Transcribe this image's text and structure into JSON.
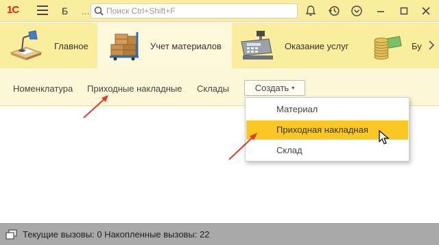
{
  "titlebar": {
    "logo": "1С",
    "app_title": "Б",
    "app_title_sep": "...",
    "search_placeholder": "Поиск Ctrl+Shift+F",
    "icons": [
      "bell-icon",
      "history-icon",
      "settings-menu-icon",
      "minimize-icon",
      "maximize-icon",
      "close-icon"
    ]
  },
  "sections": {
    "items": [
      {
        "label": "Главное",
        "icon": "desk-lamp-icon",
        "active": false
      },
      {
        "label": "Учет материалов",
        "icon": "boxes-cart-icon",
        "active": true
      },
      {
        "label": "Оказание услуг",
        "icon": "cash-register-icon",
        "active": false
      },
      {
        "label": "Бу",
        "icon": "coins-icon",
        "active": false
      }
    ],
    "next_icon": "chevron-right-icon"
  },
  "navpanel": {
    "links": [
      "Номенклатура",
      "Приходные накладные",
      "Склады"
    ],
    "create_label": "Создать",
    "create_caret": "▾"
  },
  "dropdown": {
    "items": [
      {
        "label": "Материал",
        "highlighted": false
      },
      {
        "label": "Приходная накладная",
        "highlighted": true
      },
      {
        "label": "Склад",
        "highlighted": false
      }
    ]
  },
  "statusbar": {
    "text": "Текущие вызовы: 0   Накопленные вызовы: 22"
  },
  "colors": {
    "title_bg": "#fbed9e",
    "panel_bg": "#fdf7d8",
    "highlight": "#fbc725",
    "status_bg": "#a9a9a9",
    "logo_red": "#d9251d"
  }
}
